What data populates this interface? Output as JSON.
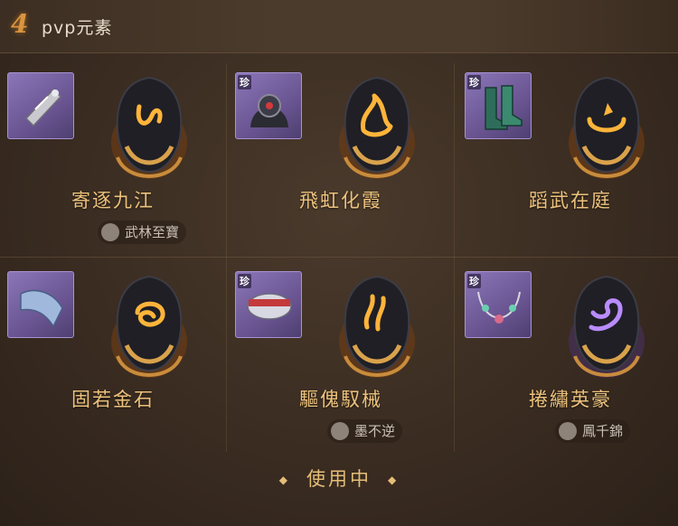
{
  "header": {
    "number": "4",
    "title": "pvp元素"
  },
  "cells": [
    {
      "skill": "寄逐九江",
      "rare": "",
      "owner": "武林至寶",
      "rune_color": "#ffb43a"
    },
    {
      "skill": "飛虹化霞",
      "rare": "珍",
      "owner": "",
      "rune_color": "#ffb43a"
    },
    {
      "skill": "蹈武在庭",
      "rare": "珍",
      "owner": "",
      "rune_color": "#ffb43a"
    },
    {
      "skill": "固若金石",
      "rare": "",
      "owner": "",
      "rune_color": "#ffb43a"
    },
    {
      "skill": "驅傀馭械",
      "rare": "珍",
      "owner": "墨不逆",
      "rune_color": "#ffb43a"
    },
    {
      "skill": "捲繡英豪",
      "rare": "珍",
      "owner": "鳳千錦",
      "rune_color": "#b98cff"
    }
  ],
  "footer": {
    "status": "使用中"
  }
}
